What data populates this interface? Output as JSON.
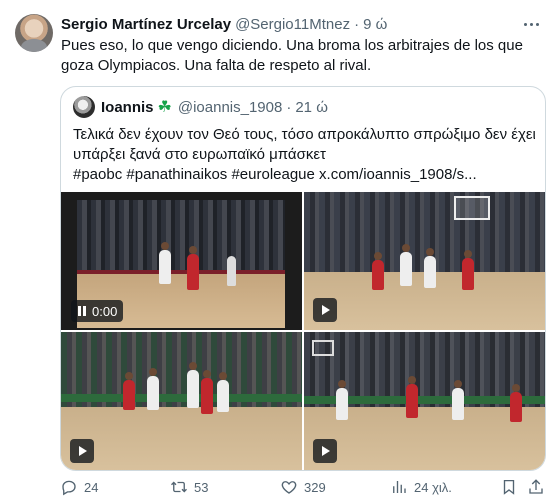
{
  "tweet": {
    "author_name": "Sergio Martínez Urcelay",
    "author_handle": "@Sergio11Mtnez",
    "separator": "·",
    "time": "9 ώ",
    "text": "Pues eso, lo que vengo diciendo. Una broma los arbitrajes de los que goza Olympiacos. Una falta de respeto al rival."
  },
  "quote": {
    "author_name": "Ioannis",
    "badge_icon": "clover-icon",
    "author_handle": "@ioannis_1908",
    "separator": "·",
    "time": "21 ώ",
    "lines": [
      "Τελικά δεν έχουν τον Θεό τους, τόσο απροκάλυπτο σπρώξιμο δεν έχει",
      "υπάρξει ξανά στο ευρωπαϊκό μπάσκετ",
      "#paobc #panathinaikos #euroleague  x.com/ioannis_1908/s..."
    ],
    "media": {
      "video1_time": "0:00"
    }
  },
  "actions": {
    "replies": "24",
    "retweets": "53",
    "likes": "329",
    "views": "24 χιλ."
  },
  "colors": {
    "secondary_text": "#536471",
    "border": "#cfd9de",
    "clover": "#16a34a"
  }
}
